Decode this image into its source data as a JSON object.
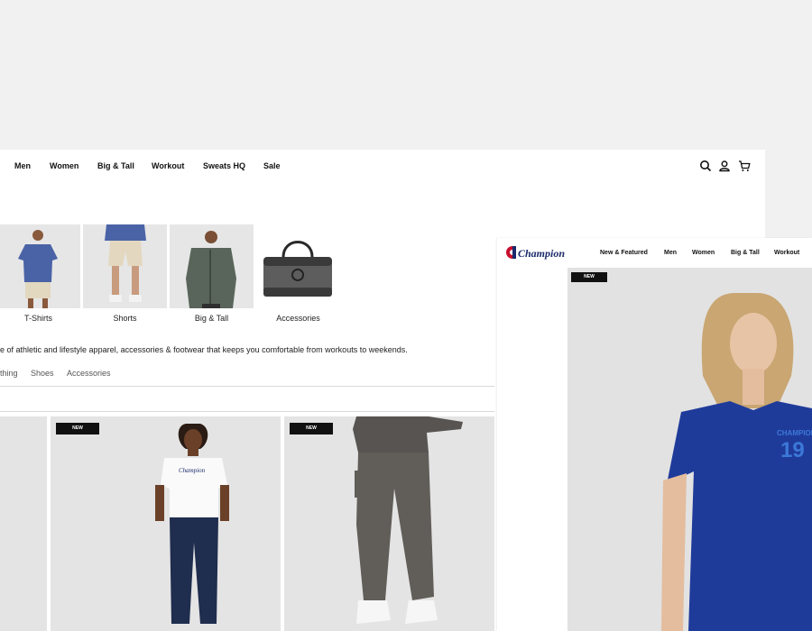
{
  "back_window": {
    "nav": [
      "Men",
      "Women",
      "Big & Tall",
      "Workout",
      "Sweats HQ",
      "Sale"
    ],
    "icons": [
      "search-icon",
      "account-icon",
      "cart-icon"
    ],
    "categories": [
      {
        "label": "T-Shirts"
      },
      {
        "label": "Shorts"
      },
      {
        "label": "Big & Tall"
      },
      {
        "label": "Accessories"
      }
    ],
    "description": "e of athletic and lifestyle apparel, accessories & footwear that keeps you comfortable from workouts to weekends.",
    "subtabs": [
      "thing",
      "Shoes",
      "Accessories"
    ],
    "products": [
      {
        "badge": ""
      },
      {
        "badge": "NEW",
        "shirt_text": "Champion"
      },
      {
        "badge": "NEW"
      }
    ]
  },
  "front_window": {
    "logo": "Champion",
    "nav": [
      "New & Featured",
      "Men",
      "Women",
      "Big & Tall",
      "Workout"
    ],
    "hero": {
      "badge": "NEW",
      "shirt_text": "CHAMPION",
      "shirt_number": "19"
    }
  },
  "colors": {
    "accent_blue": "#1f3b9a",
    "badge_black": "#111111",
    "champion_red": "#c8102e",
    "champion_navy": "#1b2a6b"
  }
}
